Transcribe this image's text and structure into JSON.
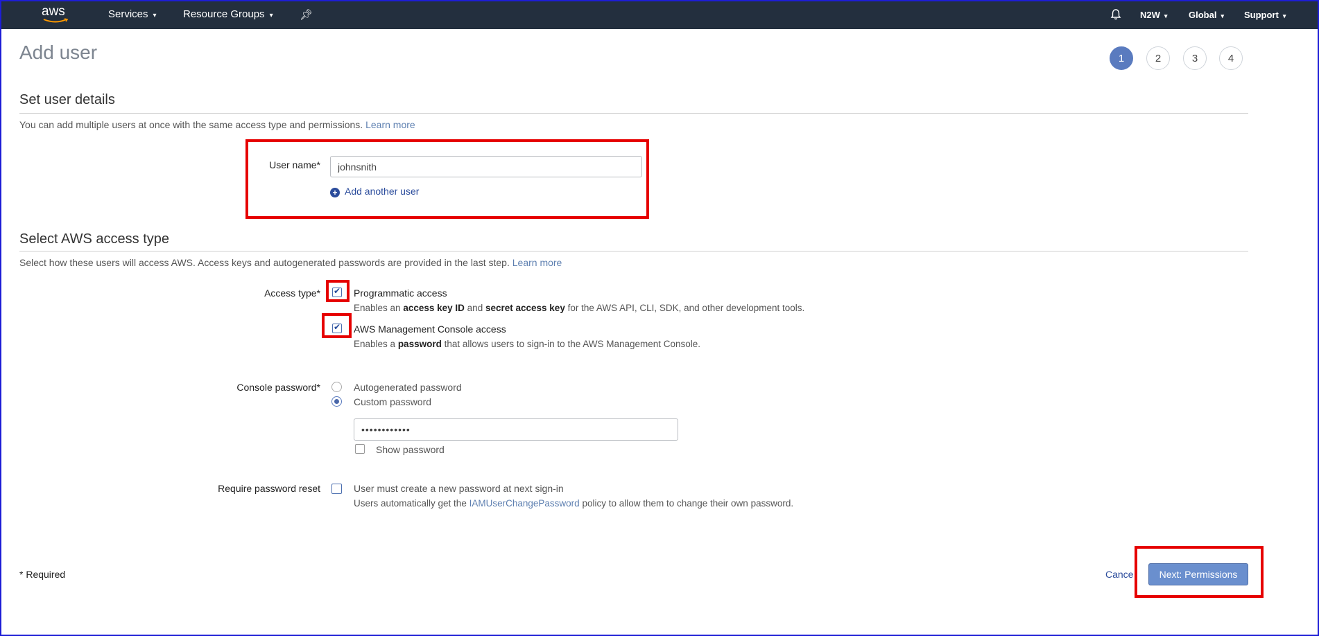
{
  "topnav": {
    "logo_text": "aws",
    "services": "Services",
    "resource_groups": "Resource Groups",
    "account": "N2W",
    "region": "Global",
    "support": "Support"
  },
  "page": {
    "title": "Add user",
    "steps": [
      "1",
      "2",
      "3",
      "4"
    ],
    "active_step": 1
  },
  "details": {
    "title": "Set user details",
    "desc": "You can add multiple users at once with the same access type and permissions.",
    "learn_more": "Learn more",
    "user_name_label": "User name*",
    "user_name_value": "johnsnith",
    "add_another": "Add another user"
  },
  "access": {
    "title": "Select AWS access type",
    "desc": "Select how these users will access AWS. Access keys and autogenerated passwords are provided in the last step.",
    "learn_more": "Learn more",
    "access_type_label": "Access type*",
    "programmatic": {
      "title": "Programmatic access",
      "desc_1": "Enables an",
      "desc_b1": "access key ID",
      "desc_2": "and",
      "desc_b2": "secret access key",
      "desc_3": "for the AWS API, CLI, SDK, and other development tools.",
      "checked": true
    },
    "console": {
      "title": "AWS Management Console access",
      "desc_1": "Enables a",
      "desc_b1": "password",
      "desc_2": "that allows users to sign-in to the AWS Management Console.",
      "checked": true
    },
    "console_password_label": "Console password*",
    "autogenerated": "Autogenerated password",
    "custom": "Custom password",
    "password_value": "••••••••••••",
    "show_password": "Show password",
    "reset_label": "Require password reset",
    "reset_text": "User must create a new password at next sign-in",
    "reset_note_1": "Users automatically get the",
    "reset_note_link": "IAMUserChangePassword",
    "reset_note_2": "policy to allow them to change their own password."
  },
  "footer": {
    "required": "* Required",
    "cancel": "Cance",
    "next": "Next: Permissions"
  },
  "colors": {
    "nav_bg": "#232f3e",
    "accent": "#5a7bbf",
    "highlight": "#e60000"
  }
}
